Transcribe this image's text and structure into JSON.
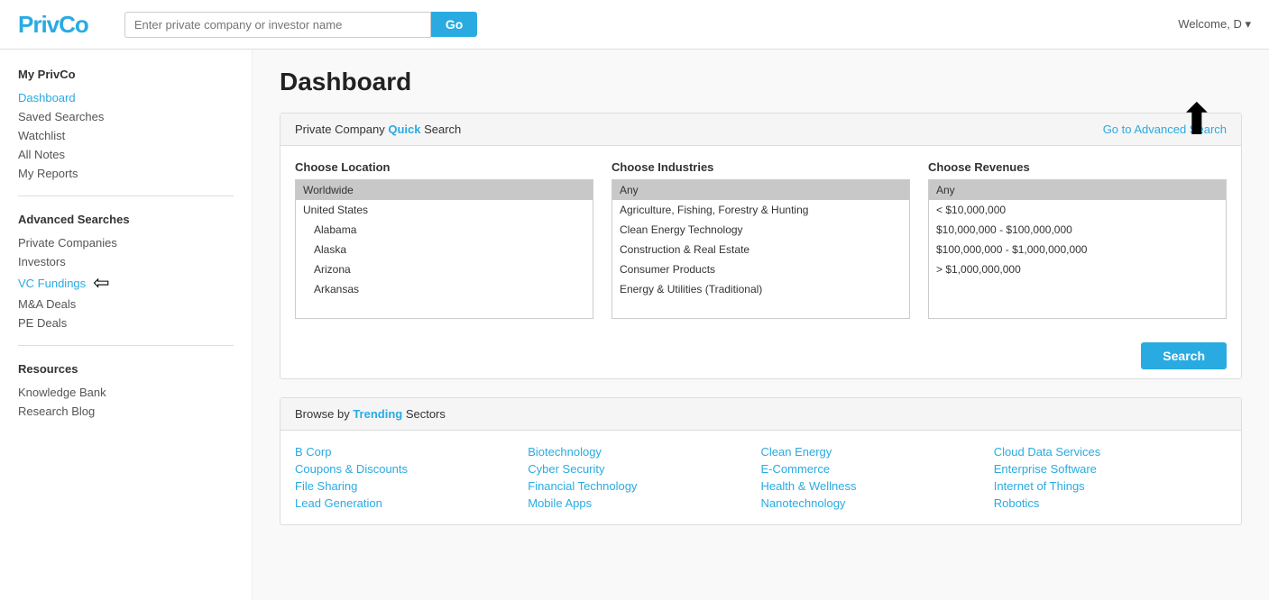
{
  "header": {
    "logo": "PrivCo",
    "search_placeholder": "Enter private company or investor name",
    "go_button": "Go",
    "welcome": "Welcome,",
    "user": "D"
  },
  "sidebar": {
    "my_privco_title": "My PrivCo",
    "my_privco_items": [
      "Dashboard",
      "Saved Searches",
      "Watchlist",
      "All Notes",
      "My Reports"
    ],
    "advanced_title": "Advanced Searches",
    "advanced_items": [
      "Private Companies",
      "Investors",
      "VC Fundings",
      "M&A Deals",
      "PE Deals"
    ],
    "resources_title": "Resources",
    "resources_items": [
      "Knowledge Bank",
      "Research Blog"
    ]
  },
  "main": {
    "page_title": "Dashboard",
    "quick_search": {
      "title": "Private Company Quick Search",
      "quick_highlight": "Quick",
      "advanced_link": "Go to Advanced Search",
      "location_label": "Choose Location",
      "location_items": [
        {
          "label": "Worldwide",
          "selected": true,
          "indent": false
        },
        {
          "label": "United States",
          "selected": false,
          "indent": false
        },
        {
          "label": "Alabama",
          "selected": false,
          "indent": true
        },
        {
          "label": "Alaska",
          "selected": false,
          "indent": true
        },
        {
          "label": "Arizona",
          "selected": false,
          "indent": true
        },
        {
          "label": "Arkansas",
          "selected": false,
          "indent": true
        }
      ],
      "industry_label": "Choose Industries",
      "industry_items": [
        {
          "label": "Any",
          "selected": true
        },
        {
          "label": "Agriculture, Fishing, Forestry & Hunting",
          "selected": false
        },
        {
          "label": "Clean Energy Technology",
          "selected": false
        },
        {
          "label": "Construction & Real Estate",
          "selected": false
        },
        {
          "label": "Consumer Products",
          "selected": false
        },
        {
          "label": "Energy & Utilities (Traditional)",
          "selected": false
        }
      ],
      "revenue_label": "Choose Revenues",
      "revenue_items": [
        {
          "label": "Any",
          "selected": true
        },
        {
          "label": "< $10,000,000",
          "selected": false
        },
        {
          "label": "$10,000,000 - $100,000,000",
          "selected": false
        },
        {
          "label": "$100,000,000 - $1,000,000,000",
          "selected": false
        },
        {
          "label": "> $1,000,000,000",
          "selected": false
        }
      ],
      "search_button": "Search"
    },
    "trending": {
      "title": "Browse by Trending Sectors",
      "browse_highlight": "Trending",
      "col1": [
        "B Corp",
        "Coupons & Discounts",
        "File Sharing",
        "Lead Generation"
      ],
      "col2": [
        "Biotechnology",
        "Cyber Security",
        "Financial Technology",
        "Mobile Apps"
      ],
      "col3": [
        "Clean Energy",
        "E-Commerce",
        "Health & Wellness",
        "Nanotechnology"
      ],
      "col4": [
        "Cloud Data Services",
        "Enterprise Software",
        "Internet of Things",
        "Robotics"
      ]
    }
  }
}
